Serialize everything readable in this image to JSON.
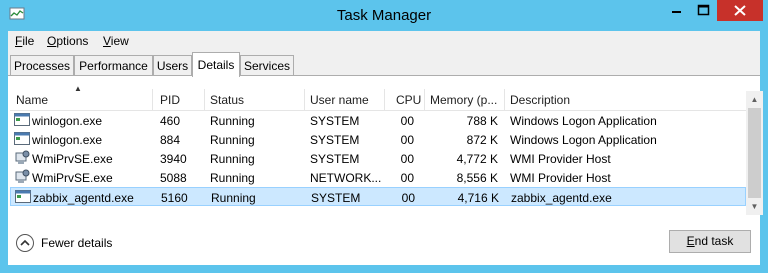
{
  "window": {
    "title": "Task Manager"
  },
  "menu": {
    "file": {
      "accel": "F",
      "rest": "ile"
    },
    "options": {
      "accel": "O",
      "rest": "ptions"
    },
    "view": {
      "accel": "V",
      "rest": "iew"
    }
  },
  "tabs": [
    "Processes",
    "Performance",
    "Users",
    "Details",
    "Services"
  ],
  "active_tab": "Details",
  "columns": [
    "Name",
    "PID",
    "Status",
    "User name",
    "CPU",
    "Memory (p...",
    "Description"
  ],
  "sort": {
    "column": "Name",
    "direction": "ascending"
  },
  "rows": [
    {
      "name": "winlogon.exe",
      "pid": "460",
      "status": "Running",
      "user": "SYSTEM",
      "cpu": "00",
      "memory": "788 K",
      "description": "Windows Logon Application",
      "icon": "window-app-icon"
    },
    {
      "name": "winlogon.exe",
      "pid": "884",
      "status": "Running",
      "user": "SYSTEM",
      "cpu": "00",
      "memory": "872 K",
      "description": "Windows Logon Application",
      "icon": "window-app-icon"
    },
    {
      "name": "WmiPrvSE.exe",
      "pid": "3940",
      "status": "Running",
      "user": "SYSTEM",
      "cpu": "00",
      "memory": "4,772 K",
      "description": "WMI Provider Host",
      "icon": "wmi-provider-icon"
    },
    {
      "name": "WmiPrvSE.exe",
      "pid": "5088",
      "status": "Running",
      "user": "NETWORK...",
      "cpu": "00",
      "memory": "8,556 K",
      "description": "WMI Provider Host",
      "icon": "wmi-provider-icon"
    },
    {
      "name": "zabbix_agentd.exe",
      "pid": "5160",
      "status": "Running",
      "user": "SYSTEM",
      "cpu": "00",
      "memory": "4,716 K",
      "description": "zabbix_agentd.exe",
      "icon": "window-app-icon",
      "selected": true
    }
  ],
  "footer": {
    "fewer_details": "Fewer details",
    "end_task": {
      "accel": "E",
      "rest": "nd task"
    }
  },
  "colors": {
    "titlebar": "#5cc4ec",
    "close_button": "#c7312a",
    "selection": "#cce8ff"
  }
}
